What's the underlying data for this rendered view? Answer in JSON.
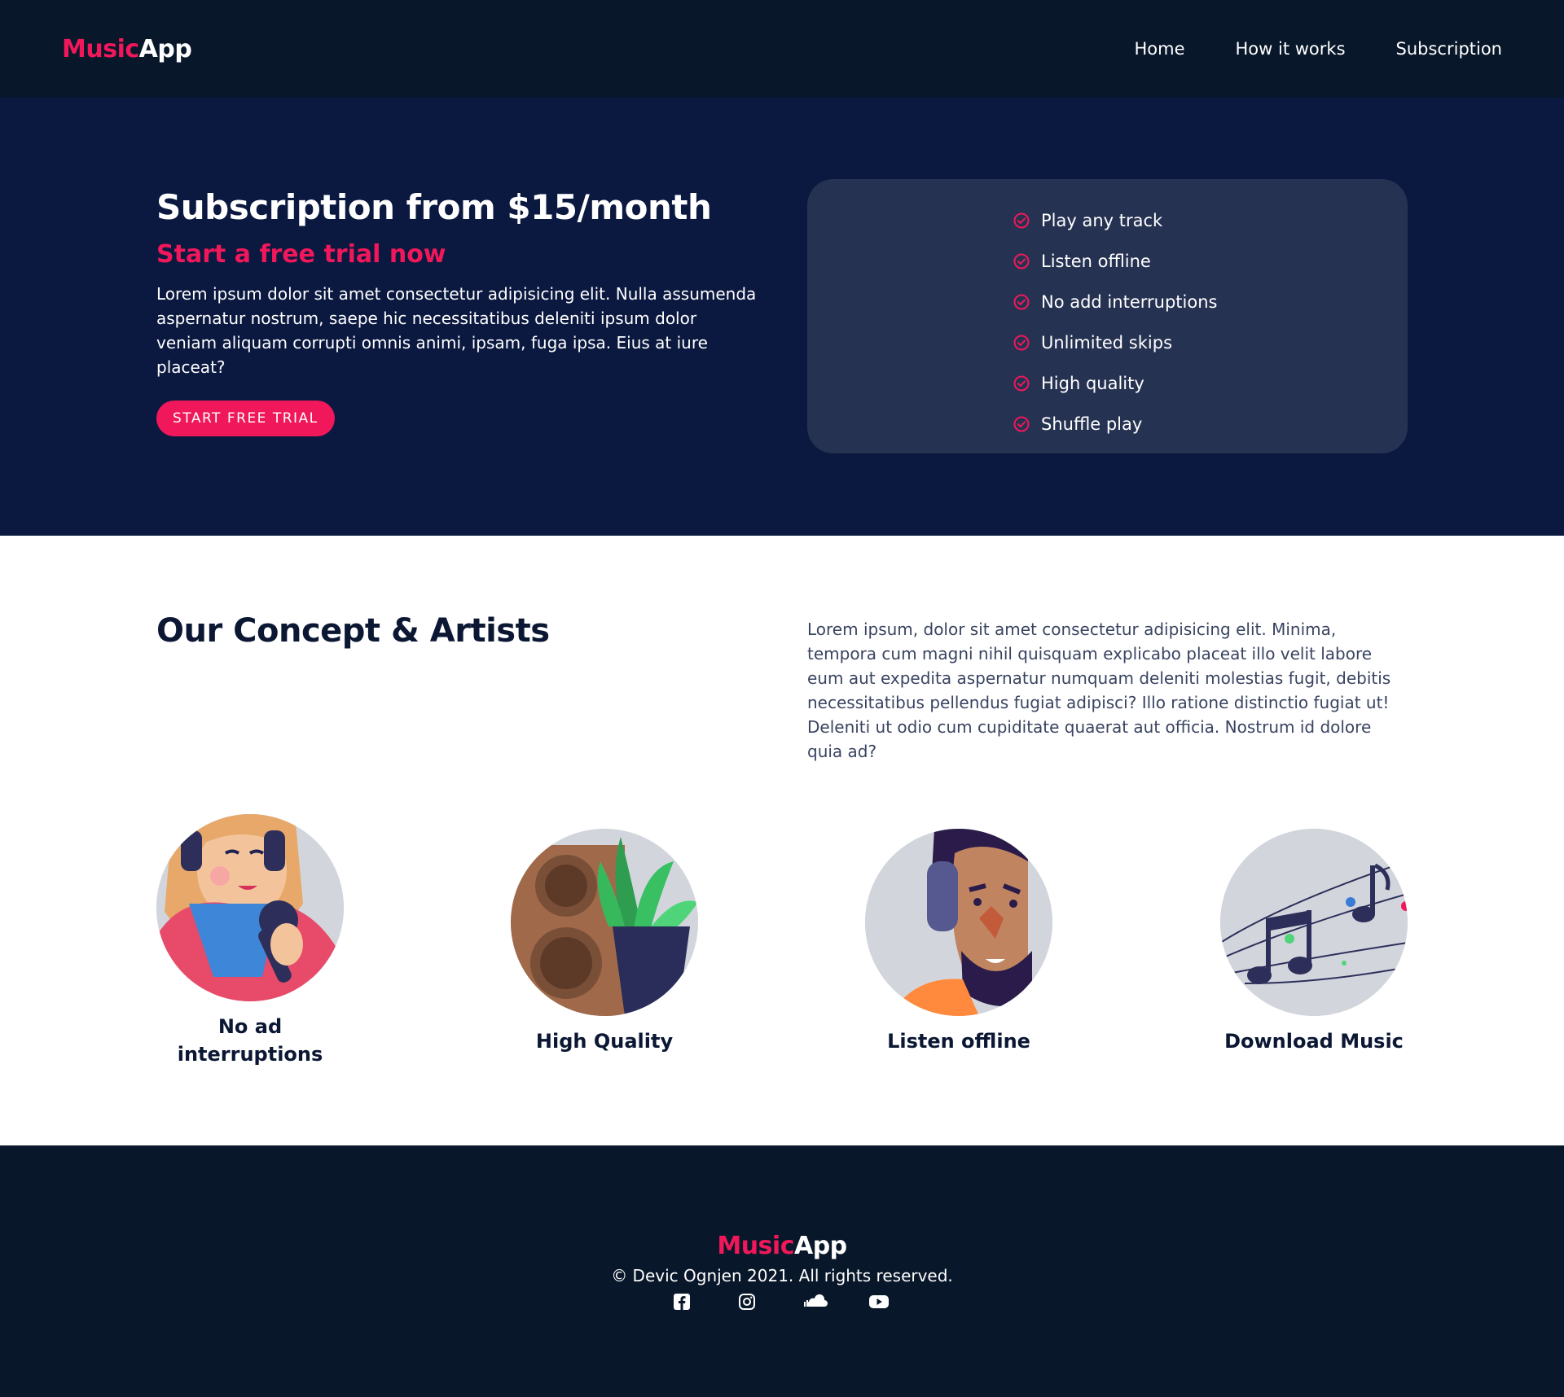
{
  "colors": {
    "accent": "#f0185a",
    "header_bg": "#08172a",
    "hero_bg": "#0b1940",
    "card_bg": "#263252"
  },
  "header": {
    "logo_accent": "Music",
    "logo_plain": "App",
    "nav": [
      {
        "label": "Home"
      },
      {
        "label": "How it works"
      },
      {
        "label": "Subscription"
      }
    ]
  },
  "hero": {
    "title": "Subscription from $15/month",
    "subtitle": "Start a free trial now",
    "text": "Lorem ipsum dolor sit amet consectetur adipisicing elit. Nulla assumenda aspernatur nostrum, saepe hic necessitatibus deleniti ipsum dolor veniam aliquam corrupti omnis animi, ipsam, fuga ipsa. Eius at iure placeat?",
    "cta_label": "START FREE TRIAL",
    "features": [
      {
        "label": "Play any track",
        "icon": "check-circle-icon"
      },
      {
        "label": "Listen offline",
        "icon": "check-circle-icon"
      },
      {
        "label": "No add interruptions",
        "icon": "check-circle-icon"
      },
      {
        "label": "Unlimited skips",
        "icon": "check-circle-icon"
      },
      {
        "label": "High quality",
        "icon": "check-circle-icon"
      },
      {
        "label": "Shuffle play",
        "icon": "check-circle-icon"
      }
    ]
  },
  "concept": {
    "title": "Our Concept & Artists",
    "text": "Lorem ipsum, dolor sit amet consectetur adipisicing elit. Minima, tempora cum magni nihil quisquam explicabo placeat illo velit labore eum aut expedita aspernatur numquam deleniti molestias fugit, debitis necessitatibus pellendus fugiat adipisci? Illo ratione distinctio fugiat ut! Deleniti ut odio cum cupiditate quaerat aut officia. Nostrum id dolore quia ad?",
    "items": [
      {
        "label": "No ad interruptions",
        "icon": "singer-illustration"
      },
      {
        "label": "High Quality",
        "icon": "speaker-plant-illustration"
      },
      {
        "label": "Listen offline",
        "icon": "man-headphones-illustration"
      },
      {
        "label": "Download Music",
        "icon": "music-notes-illustration"
      }
    ]
  },
  "footer": {
    "logo_accent": "Music",
    "logo_plain": "App",
    "copyright": "© Devic Ognjen 2021. All rights reserved.",
    "socials": [
      {
        "icon": "facebook-icon"
      },
      {
        "icon": "instagram-icon"
      },
      {
        "icon": "soundcloud-icon"
      },
      {
        "icon": "youtube-icon"
      }
    ]
  }
}
